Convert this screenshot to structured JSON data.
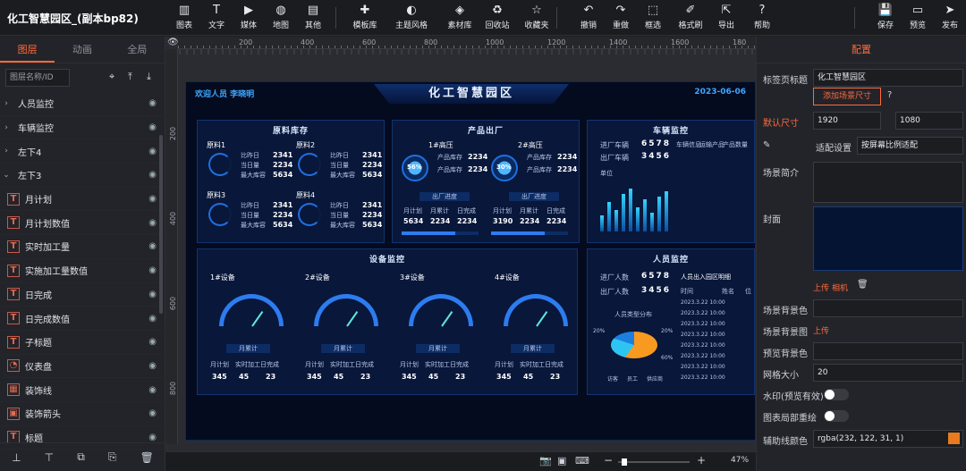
{
  "app": {
    "title": "化工智慧园区_(副本bp82)"
  },
  "toolbar": {
    "items": [
      {
        "icon": "chart-icon",
        "label": "图表"
      },
      {
        "icon": "text-icon",
        "label": "文字"
      },
      {
        "icon": "media-icon",
        "label": "媒体"
      },
      {
        "icon": "map-icon",
        "label": "地图"
      },
      {
        "icon": "other-icon",
        "label": "其他"
      },
      {
        "icon": "template-icon",
        "label": "模板库"
      },
      {
        "icon": "theme-icon",
        "label": "主题风格"
      },
      {
        "icon": "material-icon",
        "label": "素材库"
      },
      {
        "icon": "recycle-icon",
        "label": "回收站"
      },
      {
        "icon": "favorite-icon",
        "label": "收藏夹"
      },
      {
        "icon": "undo-icon",
        "label": "撤销"
      },
      {
        "icon": "redo-icon",
        "label": "重做"
      },
      {
        "icon": "select-icon",
        "label": "框选"
      },
      {
        "icon": "format-brush-icon",
        "label": "格式刷"
      },
      {
        "icon": "export-icon",
        "label": "导出"
      },
      {
        "icon": "help-icon",
        "label": "帮助"
      }
    ],
    "save": "保存",
    "preview": "预览",
    "publish": "发布"
  },
  "left_panel": {
    "tabs": [
      "图层",
      "动画",
      "全局"
    ],
    "search_placeholder": "图层名称/ID",
    "layers": [
      {
        "type": "group",
        "name": "人员监控"
      },
      {
        "type": "group",
        "name": "车辆监控"
      },
      {
        "type": "group",
        "name": "左下4"
      },
      {
        "type": "group",
        "name": "左下3"
      },
      {
        "type": "text",
        "name": "月计划"
      },
      {
        "type": "text",
        "name": "月计划数值"
      },
      {
        "type": "text",
        "name": "实时加工量"
      },
      {
        "type": "text",
        "name": "实施加工量数值"
      },
      {
        "type": "text",
        "name": "日完成"
      },
      {
        "type": "text",
        "name": "日完成数值"
      },
      {
        "type": "text",
        "name": "子标题"
      },
      {
        "type": "gauge",
        "name": "仪表盘"
      },
      {
        "type": "deco",
        "name": "装饰线"
      },
      {
        "type": "arrow",
        "name": "装饰箭头"
      },
      {
        "type": "text",
        "name": "标题"
      }
    ]
  },
  "ruler": {
    "h": [
      "200",
      "400",
      "600",
      "800",
      "1000",
      "1200",
      "1400",
      "1600",
      "180"
    ],
    "v": [
      "200",
      "400",
      "600",
      "800"
    ]
  },
  "screen": {
    "title": "化工智慧园区",
    "welcome": "欢迎人员 李晓明",
    "date": "2023-06-06",
    "panels": {
      "stock": {
        "title": "原料库存",
        "items": [
          {
            "name": "原料1",
            "v1": "2341",
            "v2": "2234",
            "v3": "5634"
          },
          {
            "name": "原料2",
            "v1": "2341",
            "v2": "2234",
            "v3": "5634"
          },
          {
            "name": "原料3",
            "v1": "2341",
            "v2": "2234",
            "v3": "5634"
          },
          {
            "name": "原料4",
            "v1": "2341",
            "v2": "2234",
            "v3": "5634"
          }
        ],
        "labels": [
          "比昨日",
          "当日量",
          "最大库容"
        ]
      },
      "output": {
        "title": "产品出厂",
        "lines": [
          {
            "name": "1#高压",
            "pct": "56%",
            "a": "2234",
            "b": "2234",
            "tag": "出厂进度",
            "nums": [
              "5634",
              "2234",
              "2234"
            ]
          },
          {
            "name": "2#高压",
            "pct": "30%",
            "a": "2234",
            "b": "2234",
            "tag": "出厂进度",
            "nums": [
              "3190",
              "2234",
              "2234"
            ]
          }
        ],
        "small_labels": [
          "产品库存",
          "产品库存",
          "月计划",
          "月累计",
          "日完成"
        ]
      },
      "vehicle": {
        "title": "车辆监控",
        "in_label": "进厂车辆",
        "in_value": "6578",
        "out_label": "出厂车辆",
        "out_value": "3456",
        "cols": [
          "车辆信息",
          "运输产品",
          "产品数量"
        ],
        "unit": "单位",
        "bars": [
          0.3,
          0.55,
          0.4,
          0.7,
          0.8,
          0.45,
          0.6,
          0.35,
          0.65,
          0.75
        ]
      },
      "devices": {
        "title": "设备监控",
        "items": [
          {
            "name": "1#设备",
            "a": "345",
            "b": "45",
            "c": "23"
          },
          {
            "name": "2#设备",
            "a": "345",
            "b": "45",
            "c": "23"
          },
          {
            "name": "3#设备",
            "a": "345",
            "b": "45",
            "c": "23"
          },
          {
            "name": "4#设备",
            "a": "345",
            "b": "45",
            "c": "23"
          }
        ],
        "gauge_label": "月累计",
        "cols": [
          "月计划",
          "实时加工",
          "日完成"
        ]
      },
      "people": {
        "title": "人员监控",
        "in_label": "进厂人数",
        "in_value": "6578",
        "out_label": "出厂人数",
        "out_value": "3456",
        "table_title": "人员出入园区明细",
        "cols": [
          "时间",
          "姓名",
          "位"
        ],
        "rows": [
          "2023.3.22 10:00",
          "2023.3.22 10:00",
          "2023.3.22 10:00",
          "2023.3.22 10:00",
          "2023.3.22 10:00",
          "2023.3.22 10:00",
          "2023.3.22 10:00",
          "2023.3.22 10:00"
        ],
        "pie_title": "人员类型分布",
        "pie_labels": [
          "20%",
          "20%",
          "60%"
        ],
        "legend": [
          "访客",
          "员工",
          "供应商"
        ]
      }
    }
  },
  "status": {
    "zoom": "47%"
  },
  "right_panel": {
    "title": "配置",
    "tab_title_label": "标签页标题",
    "tab_title_value": "化工智慧园区",
    "add_size_button": "添加场景尺寸",
    "default_size_label": "默认尺寸",
    "width": "1920",
    "height": "1080",
    "adapt_label": "适配设置",
    "adapt_value": "按屏幕比例适配",
    "intro_label": "场景简介",
    "cover_label": "封面",
    "upload": "上传",
    "camera": "相机",
    "bg_color_label": "场景背景色",
    "bg_image_label": "场景背景图",
    "bg_image_upload": "上传",
    "preview_bg_label": "预览背景色",
    "grid_label": "网格大小",
    "grid_value": "20",
    "watermark_label": "水印(预览有效)",
    "partial_label": "图表局部重绘",
    "guide_color_label": "辅助线颜色",
    "guide_color_value": "rgba(232, 122, 31, 1)",
    "accent": "#ff6a3d"
  }
}
